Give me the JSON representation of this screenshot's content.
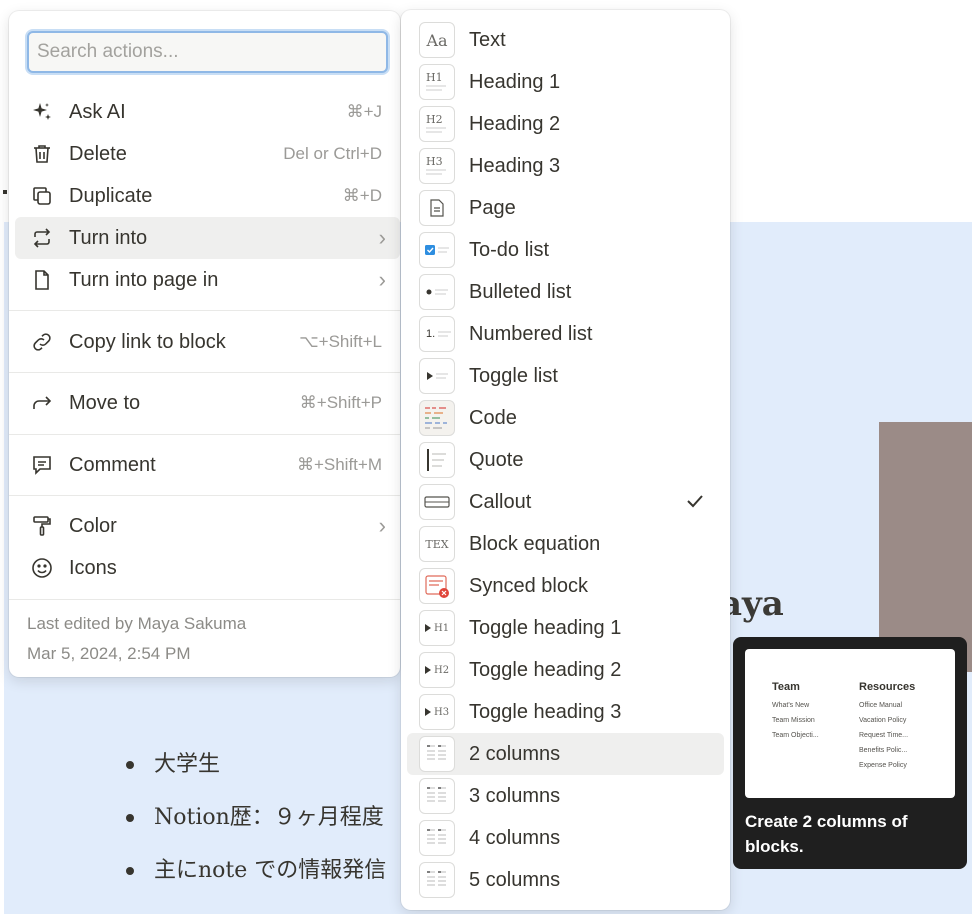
{
  "background": {
    "name_fragment": "aya",
    "bullets": [
      "大学生",
      "Notion歴：９ヶ月程度",
      "主にnote での情報発信"
    ]
  },
  "actions_menu": {
    "search_placeholder": "Search actions...",
    "items": [
      {
        "label": "Ask AI",
        "shortcut": "⌘+J",
        "icon": "sparkle-icon"
      },
      {
        "label": "Delete",
        "shortcut": "Del or Ctrl+D",
        "icon": "trash-icon"
      },
      {
        "label": "Duplicate",
        "shortcut": "⌘+D",
        "icon": "duplicate-icon"
      },
      {
        "label": "Turn into",
        "shortcut": "",
        "icon": "turn-into-icon"
      },
      {
        "label": "Turn into page in",
        "shortcut": "",
        "icon": "page-icon"
      },
      {
        "label": "Copy link to block",
        "shortcut": "⌥+Shift+L",
        "icon": "link-icon"
      },
      {
        "label": "Move to",
        "shortcut": "⌘+Shift+P",
        "icon": "move-arrow-icon"
      },
      {
        "label": "Comment",
        "shortcut": "⌘+Shift+M",
        "icon": "comment-icon"
      },
      {
        "label": "Color",
        "shortcut": "",
        "icon": "paint-roller-icon"
      },
      {
        "label": "Icons",
        "shortcut": "",
        "icon": "smiley-icon"
      }
    ],
    "last_edited_by": "Last edited by Maya Sakuma",
    "last_edited_at": "Mar 5, 2024, 2:54 PM"
  },
  "turn_into_menu": {
    "items": [
      {
        "label": "Text",
        "thumb": "Aa"
      },
      {
        "label": "Heading 1",
        "thumb": "H1"
      },
      {
        "label": "Heading 2",
        "thumb": "H2"
      },
      {
        "label": "Heading 3",
        "thumb": "H3"
      },
      {
        "label": "Page",
        "thumb": ""
      },
      {
        "label": "To-do list",
        "thumb": ""
      },
      {
        "label": "Bulleted list",
        "thumb": ""
      },
      {
        "label": "Numbered list",
        "thumb": "1."
      },
      {
        "label": "Toggle list",
        "thumb": ""
      },
      {
        "label": "Code",
        "thumb": ""
      },
      {
        "label": "Quote",
        "thumb": ""
      },
      {
        "label": "Callout",
        "thumb": ""
      },
      {
        "label": "Block equation",
        "thumb": "TEX"
      },
      {
        "label": "Synced block",
        "thumb": ""
      },
      {
        "label": "Toggle heading 1",
        "thumb": "H1"
      },
      {
        "label": "Toggle heading 2",
        "thumb": "H2"
      },
      {
        "label": "Toggle heading 3",
        "thumb": "H3"
      },
      {
        "label": "2 columns",
        "thumb": ""
      },
      {
        "label": "3 columns",
        "thumb": ""
      },
      {
        "label": "4 columns",
        "thumb": ""
      },
      {
        "label": "5 columns",
        "thumb": ""
      }
    ],
    "selected": "Callout",
    "hovered": "2 columns"
  },
  "tooltip": {
    "preview": {
      "col1_title": "Team",
      "col1_items": [
        "What's New",
        "Team Mission",
        "Team Objecti..."
      ],
      "col2_title": "Resources",
      "col2_items": [
        "Office Manual",
        "Vacation Policy",
        "Request Time...",
        "Benefits Polic...",
        "Expense Policy"
      ]
    },
    "text": "Create 2 columns of blocks."
  },
  "colors": {
    "callout_bg": "#e1ecfb",
    "hover_bg": "#efefee",
    "focus_ring": "#8fb8e6",
    "tooltip_bg": "#1f1f1f"
  }
}
